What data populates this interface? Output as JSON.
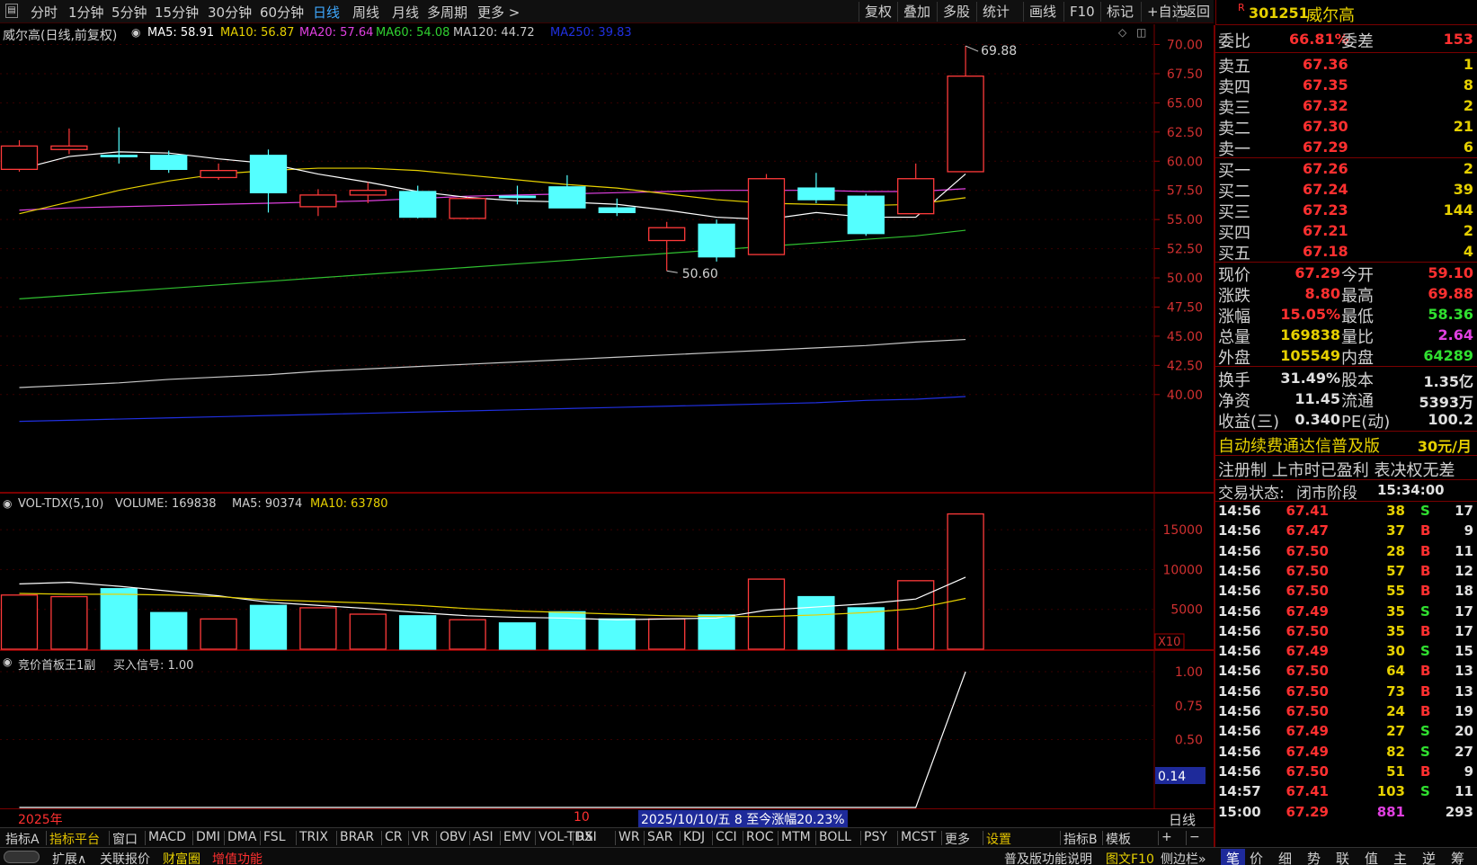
{
  "toolbar": {
    "periods": [
      "分时",
      "1分钟",
      "5分钟",
      "15分钟",
      "30分钟",
      "60分钟",
      "日线",
      "周线",
      "月线",
      "多周期",
      "更多 >"
    ],
    "active": "日线",
    "right": [
      "复权",
      "叠加",
      "多股",
      "统计",
      "画线",
      "F10",
      "标记",
      "+自选",
      "返回"
    ]
  },
  "stock": {
    "flag": "R",
    "code": "301251",
    "name": "威尔高"
  },
  "main_legend": {
    "title": "威尔高(日线,前复权)",
    "ma": [
      {
        "label": "MA5: 58.91",
        "color": "#ffffff"
      },
      {
        "label": "MA10: 56.87",
        "color": "#e6d000"
      },
      {
        "label": "MA20: 57.64",
        "color": "#e040e0"
      },
      {
        "label": "MA60: 54.08",
        "color": "#30d030"
      },
      {
        "label": "MA120: 44.72",
        "color": "#c8c8c8"
      },
      {
        "label": "MA250: 39.83",
        "color": "#2030e0"
      }
    ]
  },
  "chart_data": [
    {
      "type": "candlestick",
      "title": "威尔高(日线,前复权)",
      "ylim": [
        38.5,
        71
      ],
      "y_ticks": [
        "70.00",
        "67.50",
        "65.00",
        "62.50",
        "60.00",
        "57.50",
        "55.00",
        "52.50",
        "50.00",
        "47.50",
        "45.00",
        "42.50",
        "40.00"
      ],
      "candles": [
        {
          "o": 59.3,
          "c": 61.3,
          "h": 61.8,
          "l": 59.1,
          "up": true
        },
        {
          "o": 61.0,
          "c": 61.3,
          "h": 62.8,
          "l": 60.6,
          "up": true
        },
        {
          "o": 60.5,
          "c": 60.5,
          "h": 62.9,
          "l": 59.8,
          "up": false
        },
        {
          "o": 60.5,
          "c": 59.3,
          "h": 60.9,
          "l": 59.0,
          "up": false
        },
        {
          "o": 58.6,
          "c": 59.2,
          "h": 59.8,
          "l": 58.4,
          "up": true
        },
        {
          "o": 60.5,
          "c": 57.3,
          "h": 61.0,
          "l": 55.6,
          "up": false
        },
        {
          "o": 56.1,
          "c": 57.1,
          "h": 57.6,
          "l": 55.3,
          "up": true
        },
        {
          "o": 57.1,
          "c": 57.5,
          "h": 58.2,
          "l": 56.4,
          "up": true
        },
        {
          "o": 57.4,
          "c": 55.2,
          "h": 57.9,
          "l": 55.1,
          "up": false
        },
        {
          "o": 55.1,
          "c": 56.8,
          "h": 56.9,
          "l": 55.0,
          "up": true
        },
        {
          "o": 57.0,
          "c": 56.9,
          "h": 57.9,
          "l": 56.3,
          "up": false
        },
        {
          "o": 57.8,
          "c": 56.0,
          "h": 58.8,
          "l": 56.0,
          "up": false
        },
        {
          "o": 56.0,
          "c": 55.6,
          "h": 56.8,
          "l": 55.3,
          "up": false
        },
        {
          "o": 53.2,
          "c": 54.3,
          "h": 54.8,
          "l": 50.6,
          "up": true
        },
        {
          "o": 54.6,
          "c": 51.8,
          "h": 55.0,
          "l": 51.4,
          "up": false
        },
        {
          "o": 52.0,
          "c": 58.5,
          "h": 58.9,
          "l": 52.0,
          "up": true
        },
        {
          "o": 57.7,
          "c": 56.7,
          "h": 59.0,
          "l": 56.4,
          "up": false
        },
        {
          "o": 57.0,
          "c": 53.8,
          "h": 57.2,
          "l": 53.6,
          "up": false
        },
        {
          "o": 55.5,
          "c": 58.5,
          "h": 59.8,
          "l": 55.5,
          "up": true
        },
        {
          "o": 59.1,
          "c": 67.29,
          "h": 69.88,
          "l": 59.1,
          "up": true
        }
      ],
      "ma5": [
        59.3,
        60.4,
        60.8,
        60.7,
        60.2,
        59.8,
        58.9,
        58.2,
        57.4,
        56.9,
        56.6,
        56.5,
        56.3,
        55.8,
        55.2,
        55.0,
        55.6,
        55.2,
        55.2,
        58.91
      ],
      "ma10": [
        55.5,
        56.5,
        57.5,
        58.3,
        58.9,
        59.2,
        59.4,
        59.4,
        59.2,
        58.8,
        58.4,
        58.0,
        57.7,
        57.2,
        56.7,
        56.4,
        56.3,
        56.2,
        56.3,
        56.87
      ],
      "ma20": [
        55.8,
        56.0,
        56.1,
        56.2,
        56.3,
        56.4,
        56.5,
        56.6,
        56.8,
        57.0,
        57.1,
        57.2,
        57.3,
        57.4,
        57.5,
        57.5,
        57.5,
        57.4,
        57.4,
        57.64
      ],
      "ma60": [
        48.2,
        48.5,
        48.8,
        49.1,
        49.4,
        49.7,
        50.0,
        50.3,
        50.6,
        50.9,
        51.2,
        51.5,
        51.8,
        52.1,
        52.4,
        52.7,
        53.0,
        53.3,
        53.6,
        54.08
      ],
      "ma120": [
        40.6,
        40.8,
        41.0,
        41.3,
        41.5,
        41.7,
        42.0,
        42.2,
        42.4,
        42.6,
        42.8,
        43.0,
        43.2,
        43.4,
        43.6,
        43.8,
        44.0,
        44.2,
        44.5,
        44.72
      ],
      "ma250": [
        37.7,
        37.8,
        37.9,
        38.0,
        38.1,
        38.2,
        38.3,
        38.4,
        38.5,
        38.6,
        38.7,
        38.8,
        38.9,
        39.0,
        39.1,
        39.2,
        39.3,
        39.5,
        39.6,
        39.83
      ],
      "annotations": [
        "69.88",
        "50.60"
      ]
    },
    {
      "type": "bar",
      "title": "VOL-TDX(5,10)",
      "ylim": [
        0,
        17500
      ],
      "y_ticks": [
        "15000",
        "10000",
        "5000"
      ],
      "unit": "X10",
      "values": [
        6800,
        6600,
        7600,
        4600,
        3800,
        5500,
        5200,
        4400,
        4200,
        3700,
        3300,
        4700,
        3800,
        3800,
        4300,
        8800,
        6600,
        5200,
        8600,
        16984
      ],
      "ma5": [
        8200,
        8400,
        7900,
        7300,
        6700,
        5900,
        5500,
        5100,
        4600,
        4200,
        4000,
        3900,
        3700,
        3800,
        3900,
        4900,
        5300,
        5700,
        6300,
        9037
      ],
      "ma10": [
        7000,
        6900,
        6900,
        6800,
        6600,
        6200,
        6000,
        5800,
        5500,
        5100,
        4800,
        4600,
        4400,
        4200,
        4100,
        4100,
        4300,
        4600,
        5100,
        6378
      ]
    },
    {
      "type": "line",
      "title": "竞价首板王1副",
      "ylim": [
        0,
        1.1
      ],
      "y_ticks": [
        "1.00",
        "0.75",
        "0.50"
      ],
      "current": "0.14",
      "values": [
        0,
        0,
        0,
        0,
        0,
        0,
        0,
        0,
        0,
        0,
        0,
        0,
        0,
        0,
        0,
        0,
        0,
        0,
        0,
        1
      ]
    }
  ],
  "vol_legend": {
    "name": "VOL-TDX(5,10)",
    "volume": "VOLUME: 169838",
    "ma5": "MA5: 90374",
    "ma10": "MA10: 63780"
  },
  "ind_legend": {
    "name": "竞价首板王1副",
    "signal": "买入信号: 1.00"
  },
  "bottom_axis": {
    "year": "2025年",
    "month": "10",
    "info": "2025/10/10/五 8 至今涨幅20.23%",
    "period": "日线"
  },
  "indicator_tabs": [
    "指标A",
    "指标平台",
    "窗口",
    "MACD",
    "DMI",
    "DMA",
    "FSL",
    "TRIX",
    "BRAR",
    "CR",
    "VR",
    "OBV",
    "ASI",
    "EMV",
    "VOL-TDX",
    "RSI",
    "WR",
    "SAR",
    "KDJ",
    "CCI",
    "ROC",
    "MTM",
    "BOLL",
    "PSY",
    "MCST",
    "更多",
    "设置",
    "指标B",
    "模板",
    "+",
    "−"
  ],
  "status_bar": [
    "扩展∧",
    "关联报价",
    "财富圈",
    "增值功能",
    "普及版功能说明",
    "图文F10",
    "侧边栏»"
  ],
  "quote": {
    "weibi": {
      "label": "委比",
      "value": "66.81%",
      "label2": "委差",
      "value2": "153"
    },
    "sell": [
      {
        "label": "卖五",
        "price": "67.36",
        "vol": "1"
      },
      {
        "label": "卖四",
        "price": "67.35",
        "vol": "8"
      },
      {
        "label": "卖三",
        "price": "67.32",
        "vol": "2"
      },
      {
        "label": "卖二",
        "price": "67.30",
        "vol": "21"
      },
      {
        "label": "卖一",
        "price": "67.29",
        "vol": "6"
      }
    ],
    "buy": [
      {
        "label": "买一",
        "price": "67.26",
        "vol": "2"
      },
      {
        "label": "买二",
        "price": "67.24",
        "vol": "39"
      },
      {
        "label": "买三",
        "price": "67.23",
        "vol": "144"
      },
      {
        "label": "买四",
        "price": "67.21",
        "vol": "2"
      },
      {
        "label": "买五",
        "price": "67.18",
        "vol": "4"
      }
    ],
    "stats": [
      {
        "l1": "现价",
        "v1": "67.29",
        "c1": "#ff3030",
        "l2": "今开",
        "v2": "59.10",
        "c2": "#ff3030"
      },
      {
        "l1": "涨跌",
        "v1": "8.80",
        "c1": "#ff3030",
        "l2": "最高",
        "v2": "69.88",
        "c2": "#ff3030"
      },
      {
        "l1": "涨幅",
        "v1": "15.05%",
        "c1": "#ff3030",
        "l2": "最低",
        "v2": "58.36",
        "c2": "#30e030"
      },
      {
        "l1": "总量",
        "v1": "169838",
        "c1": "#e6d000",
        "l2": "量比",
        "v2": "2.64",
        "c2": "#e040e0"
      },
      {
        "l1": "外盘",
        "v1": "105549",
        "c1": "#e6d000",
        "l2": "内盘",
        "v2": "64289",
        "c2": "#30e030"
      }
    ],
    "stats2": [
      {
        "l1": "换手",
        "v1": "31.49%",
        "l2": "股本",
        "v2": "1.35亿"
      },
      {
        "l1": "净资",
        "v1": "11.45",
        "l2": "流通",
        "v2": "5393万"
      },
      {
        "l1": "收益(三)",
        "v1": "0.340",
        "l2": "PE(动)",
        "v2": "100.2"
      }
    ],
    "promo": "自动续费通达信普及版",
    "promo_price": "30元/月",
    "news": "注册制 上市时已盈利 表决权无差",
    "trade_state_label": "交易状态:",
    "trade_state": "闭市阶段",
    "trade_time": "15:34:00"
  },
  "ticks": [
    {
      "t": "14:56",
      "p": "67.41",
      "v": "38",
      "d": "S",
      "n": "17"
    },
    {
      "t": "14:56",
      "p": "67.47",
      "v": "37",
      "d": "B",
      "n": "9"
    },
    {
      "t": "14:56",
      "p": "67.50",
      "v": "28",
      "d": "B",
      "n": "11"
    },
    {
      "t": "14:56",
      "p": "67.50",
      "v": "57",
      "d": "B",
      "n": "12"
    },
    {
      "t": "14:56",
      "p": "67.50",
      "v": "55",
      "d": "B",
      "n": "18"
    },
    {
      "t": "14:56",
      "p": "67.49",
      "v": "35",
      "d": "S",
      "n": "17"
    },
    {
      "t": "14:56",
      "p": "67.50",
      "v": "35",
      "d": "B",
      "n": "17"
    },
    {
      "t": "14:56",
      "p": "67.49",
      "v": "30",
      "d": "S",
      "n": "15"
    },
    {
      "t": "14:56",
      "p": "67.50",
      "v": "64",
      "d": "B",
      "n": "13"
    },
    {
      "t": "14:56",
      "p": "67.50",
      "v": "73",
      "d": "B",
      "n": "13"
    },
    {
      "t": "14:56",
      "p": "67.50",
      "v": "24",
      "d": "B",
      "n": "19"
    },
    {
      "t": "14:56",
      "p": "67.49",
      "v": "27",
      "d": "S",
      "n": "20"
    },
    {
      "t": "14:56",
      "p": "67.49",
      "v": "82",
      "d": "S",
      "n": "27"
    },
    {
      "t": "14:56",
      "p": "67.50",
      "v": "51",
      "d": "B",
      "n": "9"
    },
    {
      "t": "14:57",
      "p": "67.41",
      "v": "103",
      "d": "S",
      "n": "11"
    },
    {
      "t": "15:00",
      "p": "67.29",
      "v": "881",
      "d": "",
      "n": "293"
    }
  ],
  "side_tabs": [
    "笔",
    "价",
    "细",
    "势",
    "联",
    "值",
    "主",
    "逆",
    "筹"
  ]
}
